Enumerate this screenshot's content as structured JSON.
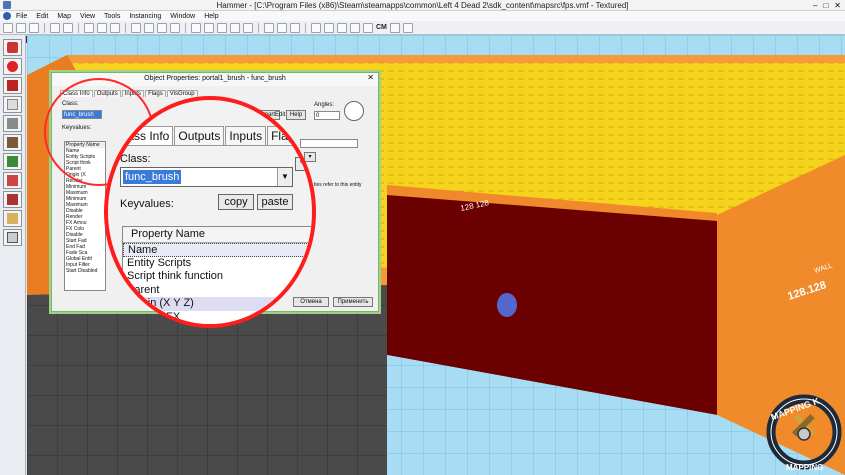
{
  "window": {
    "title": "Hammer - [C:\\Program Files (x86)\\Steam\\steamapps\\common\\Left 4 Dead 2\\sdk_content\\mapsrc\\fps.vmf - Textured]",
    "min": "–",
    "max": "□",
    "close": "✕"
  },
  "menu": [
    "File",
    "Edit",
    "Map",
    "View",
    "Tools",
    "Instancing",
    "Window",
    "Help"
  ],
  "toolbar": {
    "cm_label": "CM"
  },
  "viewport": {
    "camera_label": "camera",
    "wall_label_left": "128 128",
    "wall_label_right": "128.128",
    "wall_tag": "WALL"
  },
  "dialog": {
    "title": "Object Properties: portal1_brush - func_brush",
    "tabs": [
      "Class Info",
      "Outputs",
      "Inputs",
      "Flags",
      "VisGroup"
    ],
    "class_label": "Class:",
    "class_value": "func_brush",
    "smartedit_label": "SmartEdit",
    "help_label": "Help",
    "angles_label": "Angles:",
    "angles_value": "0",
    "keyvalues_label": "Keyvalues:",
    "note_text": "ties refer to this entity",
    "list_items": [
      "Property Name",
      "Name",
      "Entity Scripts",
      "Script think",
      "Parent",
      "Origin (X",
      "Render",
      "Minimum",
      "Maximum",
      "Minimum",
      "Maximum",
      "Disable",
      "Render",
      "FX Amou",
      "FX Colo",
      "Disable",
      "Start Fad",
      "End Fad",
      "Fade Sca",
      "Global Entit",
      "Input Filter",
      "Start Disabled"
    ],
    "cancel_label": "Отмена",
    "apply_label": "Применить"
  },
  "magnifier": {
    "tabs": [
      "Class Info",
      "Outputs",
      "Inputs",
      "Flags"
    ],
    "class_label": "Class:",
    "class_value": "func_brush",
    "keyvalues_label": "Keyvalues:",
    "copy_label": "copy",
    "paste_label": "paste",
    "grid_header": "Property Name",
    "rows": [
      "Name",
      "Entity Scripts",
      "Script think function",
      "Parent",
      "Origin (X Y Z)",
      "Render FX"
    ]
  },
  "watermark": {
    "text_top": "MAPPING K",
    "text_bottom": "MAPPING"
  }
}
